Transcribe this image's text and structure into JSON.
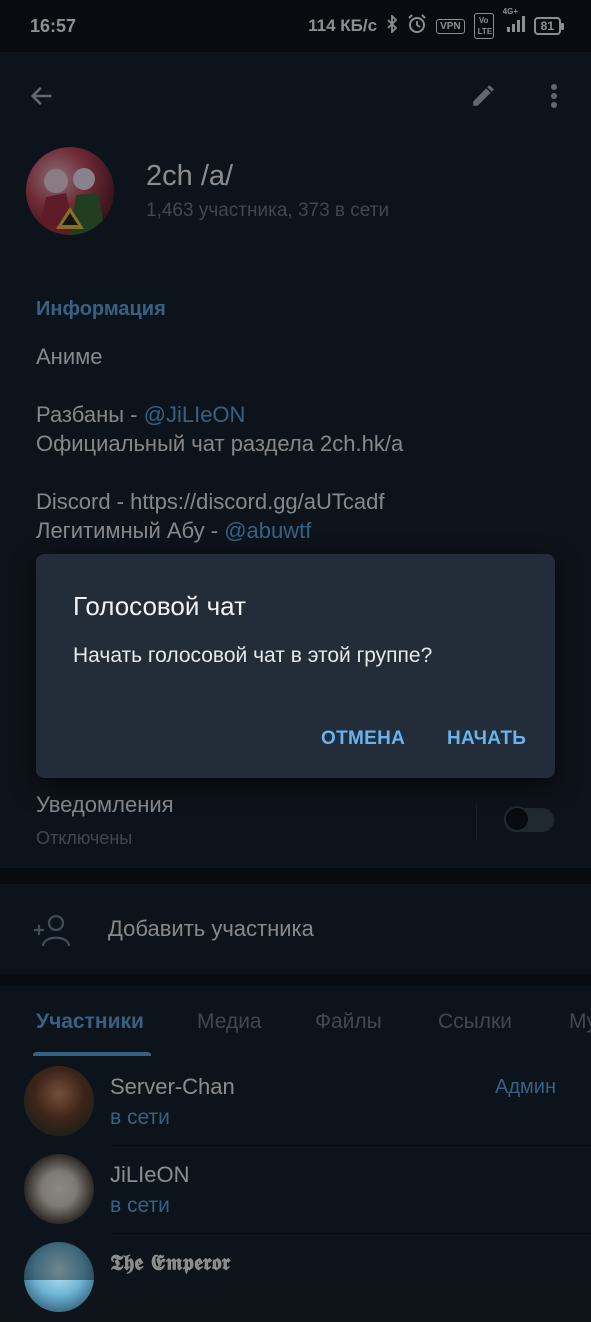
{
  "statusbar": {
    "time": "16:57",
    "speed": "114 КБ/с",
    "vpn": "VPN",
    "volte": "Vo LTE",
    "network": "4G+",
    "battery": "81"
  },
  "group": {
    "title": "2ch /a/",
    "subtitle": "1,463 участника, 373 в сети"
  },
  "info": {
    "heading": "Информация",
    "lines": {
      "l1": "Аниме",
      "l3_prefix": "Разбаны - ",
      "l3_link": "@JiLIeON",
      "l4": "Официальный чат раздела 2ch.hk/a",
      "l6": "Discord - https://discord.gg/aUTcadf",
      "l7_prefix": "Легитимный Абу - ",
      "l7_link": "@abuwtf"
    }
  },
  "notifications": {
    "label": "Уведомления",
    "status": "Отключены",
    "enabled": false
  },
  "add_member": {
    "label": "Добавить участника"
  },
  "tabs": [
    {
      "label": "Участники",
      "active": true
    },
    {
      "label": "Медиа"
    },
    {
      "label": "Файлы"
    },
    {
      "label": "Ссылки"
    },
    {
      "label": "Му"
    }
  ],
  "members": [
    {
      "name": "Server-Chan",
      "status": "в сети",
      "role": "Админ"
    },
    {
      "name": "JiLIeON",
      "status": "в сети",
      "role": ""
    },
    {
      "name": "𝕿𝖍𝖊 𝕰𝖒𝖕𝖊𝖗𝖔𝖗",
      "status": "",
      "role": ""
    }
  ],
  "dialog": {
    "title": "Голосовой чат",
    "message": "Начать голосовой чат в этой группе?",
    "cancel": "ОТМЕНА",
    "confirm": "НАЧАТЬ"
  },
  "colors": {
    "accent": "#5ea8e3",
    "background": "#18222d",
    "dialog": "#222d39"
  }
}
